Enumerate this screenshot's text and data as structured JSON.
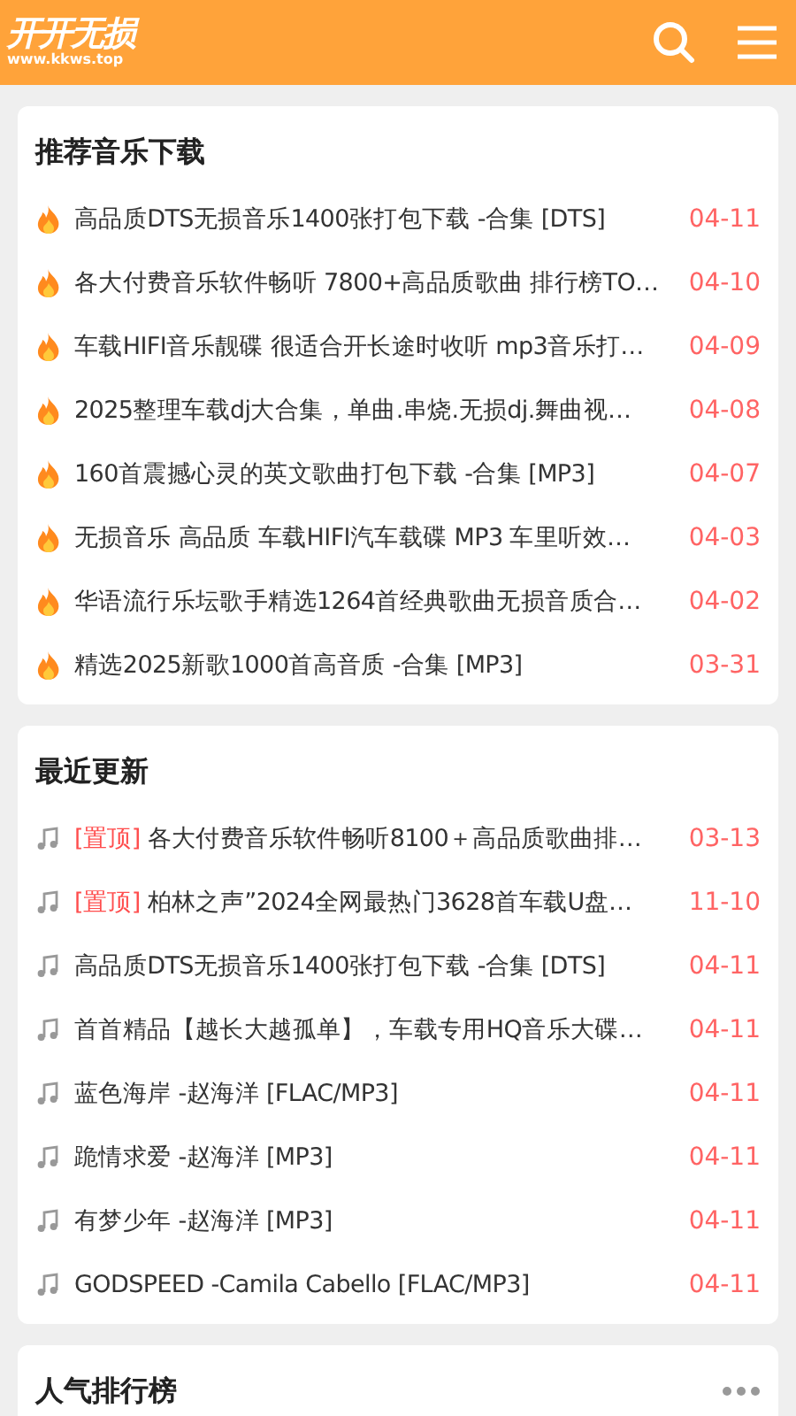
{
  "header": {
    "logo": "开开无损",
    "logo_url": "www.kkws.top"
  },
  "sections": [
    {
      "title": "推荐音乐下载",
      "kind": "hot",
      "more": false,
      "items": [
        {
          "title": "高品质DTS无损音乐1400张打包下载 -合集 [DTS]",
          "date": "04-11"
        },
        {
          "title": "各大付费音乐软件畅听 7800+高品质歌曲 排行榜TO…",
          "date": "04-10"
        },
        {
          "title": "车载HIFI音乐靓碟 很适合开长途时收听 mp3音乐打…",
          "date": "04-09"
        },
        {
          "title": "2025整理车载dj大合集，单曲.串烧.无损dj.舞曲视…",
          "date": "04-08"
        },
        {
          "title": "160首震撼心灵的英文歌曲打包下载 -合集 [MP3]",
          "date": "04-07"
        },
        {
          "title": "无损音乐 高品质 车载HIFI汽车载碟 MP3 车里听效…",
          "date": "04-03"
        },
        {
          "title": "华语流行乐坛歌手精选1264首经典歌曲无损音质合…",
          "date": "04-02"
        },
        {
          "title": "精选2025新歌1000首高音质 -合集 [MP3]",
          "date": "03-31"
        }
      ]
    },
    {
      "title": "最近更新",
      "kind": "recent",
      "more": false,
      "items": [
        {
          "tag": "[置顶]",
          "title": "各大付费音乐软件畅听8100＋高品质歌曲排…",
          "date": "03-13"
        },
        {
          "tag": "[置顶]",
          "title": "柏林之声”2024全网最热门3628首车载U盘…",
          "date": "11-10"
        },
        {
          "title": "高品质DTS无损音乐1400张打包下载 -合集 [DTS]",
          "date": "04-11"
        },
        {
          "title": "首首精品【越长大越孤单】，车载专用HQ音乐大碟…",
          "date": "04-11"
        },
        {
          "title": "蓝色海岸 -赵海洋 [FLAC/MP3]",
          "date": "04-11"
        },
        {
          "title": "跪情求爱 -赵海洋 [MP3]",
          "date": "04-11"
        },
        {
          "title": "有梦少年 -赵海洋 [MP3]",
          "date": "04-11"
        },
        {
          "title": "GODSPEED -Camila Cabello [FLAC/MP3]",
          "date": "04-11"
        }
      ]
    },
    {
      "title": "人气排行榜",
      "kind": "ranking",
      "more": true
    }
  ]
}
